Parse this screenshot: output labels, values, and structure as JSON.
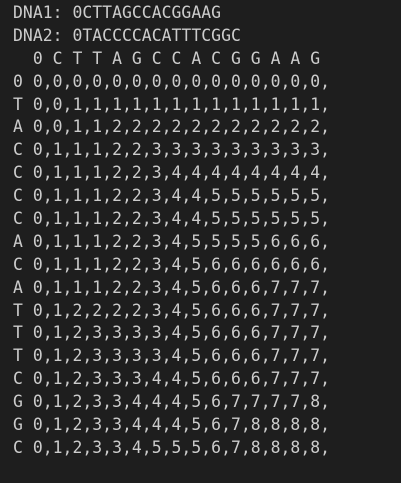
{
  "console": {
    "lines": [
      "DNA1: 0CTTAGCCACGGAAG",
      "DNA2: 0TACCCCACATTTCGGC",
      "  0 C T T A G C C A C G G A A G",
      "0 0,0,0,0,0,0,0,0,0,0,0,0,0,0,0,",
      "T 0,0,1,1,1,1,1,1,1,1,1,1,1,1,1,",
      "A 0,0,1,1,2,2,2,2,2,2,2,2,2,2,2,",
      "C 0,1,1,1,2,2,3,3,3,3,3,3,3,3,3,",
      "C 0,1,1,1,2,2,3,4,4,4,4,4,4,4,4,",
      "C 0,1,1,1,2,2,3,4,4,5,5,5,5,5,5,",
      "C 0,1,1,1,2,2,3,4,4,5,5,5,5,5,5,",
      "A 0,1,1,1,2,2,3,4,5,5,5,5,6,6,6,",
      "C 0,1,1,1,2,2,3,4,5,6,6,6,6,6,6,",
      "A 0,1,1,1,2,2,3,4,5,6,6,6,7,7,7,",
      "T 0,1,2,2,2,2,3,4,5,6,6,6,7,7,7,",
      "T 0,1,2,3,3,3,3,4,5,6,6,6,7,7,7,",
      "T 0,1,2,3,3,3,3,4,5,6,6,6,7,7,7,",
      "C 0,1,2,3,3,3,4,4,5,6,6,6,7,7,7,",
      "G 0,1,2,3,3,4,4,4,5,6,7,7,7,7,8,",
      "G 0,1,2,3,3,4,4,4,5,6,7,8,8,8,8,",
      "C 0,1,2,3,3,4,5,5,5,6,7,8,8,8,8,"
    ]
  }
}
